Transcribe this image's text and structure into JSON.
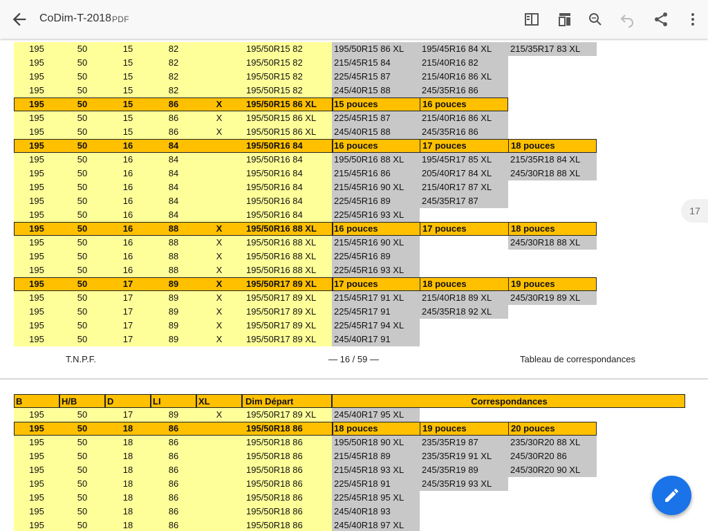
{
  "app": {
    "title": "CoDim-T-2018",
    "type_label": "PDF",
    "page_badge": "17"
  },
  "toolbar": {
    "icons": [
      "back-arrow-icon",
      "reading-mode-icon",
      "bookmark-view-icon",
      "search-icon",
      "undo-icon",
      "share-icon",
      "more-vert-icon"
    ]
  },
  "page16": {
    "rows": [
      {
        "kind": "n",
        "c": [
          "195",
          "50",
          "15",
          "82",
          "",
          "195/50R15 82"
        ],
        "g": [
          "195/50R15 86 XL",
          "195/45R16 84 XL",
          "215/35R17 83 XL"
        ]
      },
      {
        "kind": "n",
        "c": [
          "195",
          "50",
          "15",
          "82",
          "",
          "195/50R15 82"
        ],
        "g": [
          "215/45R15 84",
          "215/40R16 82",
          ""
        ]
      },
      {
        "kind": "n",
        "c": [
          "195",
          "50",
          "15",
          "82",
          "",
          "195/50R15 82"
        ],
        "g": [
          "225/45R15 87",
          "215/40R16 86 XL",
          ""
        ]
      },
      {
        "kind": "n",
        "c": [
          "195",
          "50",
          "15",
          "82",
          "",
          "195/50R15 82"
        ],
        "g": [
          "245/40R15 88",
          "245/35R16 86",
          ""
        ]
      },
      {
        "kind": "h",
        "c": [
          "195",
          "50",
          "15",
          "86",
          "X",
          "195/50R15 86 XL"
        ],
        "g": [
          "15 pouces",
          "16 pouces",
          ""
        ]
      },
      {
        "kind": "n",
        "c": [
          "195",
          "50",
          "15",
          "86",
          "X",
          "195/50R15 86 XL"
        ],
        "g": [
          "225/45R15 87",
          "215/40R16 86 XL",
          ""
        ]
      },
      {
        "kind": "n",
        "c": [
          "195",
          "50",
          "15",
          "86",
          "X",
          "195/50R15 86 XL"
        ],
        "g": [
          "245/40R15 88",
          "245/35R16 86",
          ""
        ]
      },
      {
        "kind": "h",
        "c": [
          "195",
          "50",
          "16",
          "84",
          "",
          "195/50R16 84"
        ],
        "g": [
          "16 pouces",
          "17 pouces",
          "18 pouces"
        ]
      },
      {
        "kind": "n",
        "c": [
          "195",
          "50",
          "16",
          "84",
          "",
          "195/50R16 84"
        ],
        "g": [
          "195/50R16 88 XL",
          "195/45R17 85 XL",
          "215/35R18 84 XL"
        ]
      },
      {
        "kind": "n",
        "c": [
          "195",
          "50",
          "16",
          "84",
          "",
          "195/50R16 84"
        ],
        "g": [
          "215/45R16 86",
          "205/40R17 84 XL",
          "245/30R18 88 XL"
        ]
      },
      {
        "kind": "n",
        "c": [
          "195",
          "50",
          "16",
          "84",
          "",
          "195/50R16 84"
        ],
        "g": [
          "215/45R16 90 XL",
          "215/40R17 87 XL",
          ""
        ]
      },
      {
        "kind": "n",
        "c": [
          "195",
          "50",
          "16",
          "84",
          "",
          "195/50R16 84"
        ],
        "g": [
          "225/45R16 89",
          "245/35R17 87",
          ""
        ]
      },
      {
        "kind": "n",
        "c": [
          "195",
          "50",
          "16",
          "84",
          "",
          "195/50R16 84"
        ],
        "g": [
          "225/45R16 93 XL",
          "",
          ""
        ]
      },
      {
        "kind": "h",
        "c": [
          "195",
          "50",
          "16",
          "88",
          "X",
          "195/50R16 88 XL"
        ],
        "g": [
          "16 pouces",
          "17 pouces",
          "18 pouces"
        ]
      },
      {
        "kind": "n",
        "c": [
          "195",
          "50",
          "16",
          "88",
          "X",
          "195/50R16 88 XL"
        ],
        "g": [
          "215/45R16 90 XL",
          "",
          "245/30R18 88 XL"
        ]
      },
      {
        "kind": "n",
        "c": [
          "195",
          "50",
          "16",
          "88",
          "X",
          "195/50R16 88 XL"
        ],
        "g": [
          "225/45R16 89",
          "",
          ""
        ]
      },
      {
        "kind": "n",
        "c": [
          "195",
          "50",
          "16",
          "88",
          "X",
          "195/50R16 88 XL"
        ],
        "g": [
          "225/45R16 93 XL",
          "",
          ""
        ]
      },
      {
        "kind": "h",
        "c": [
          "195",
          "50",
          "17",
          "89",
          "X",
          "195/50R17 89 XL"
        ],
        "g": [
          "17 pouces",
          "18 pouces",
          "19 pouces"
        ]
      },
      {
        "kind": "n",
        "c": [
          "195",
          "50",
          "17",
          "89",
          "X",
          "195/50R17 89 XL"
        ],
        "g": [
          "215/45R17 91 XL",
          "215/40R18 89 XL",
          "245/30R19 89 XL"
        ]
      },
      {
        "kind": "n",
        "c": [
          "195",
          "50",
          "17",
          "89",
          "X",
          "195/50R17 89 XL"
        ],
        "g": [
          "225/45R17 91",
          "245/35R18 92 XL",
          ""
        ]
      },
      {
        "kind": "n",
        "c": [
          "195",
          "50",
          "17",
          "89",
          "X",
          "195/50R17 89 XL"
        ],
        "g": [
          "225/45R17 94 XL",
          "",
          ""
        ]
      },
      {
        "kind": "n",
        "c": [
          "195",
          "50",
          "17",
          "89",
          "X",
          "195/50R17 89 XL"
        ],
        "g": [
          "245/40R17 91",
          "",
          ""
        ]
      }
    ],
    "footer_left": "T.N.P.F.",
    "footer_center": "— 16 / 59 —",
    "footer_right": "Tableau de correspondances"
  },
  "page17": {
    "headers": [
      "B",
      "H/B",
      "D",
      "LI",
      "XL",
      "Dim Départ",
      "Correspondances"
    ],
    "rows": [
      {
        "kind": "n",
        "c": [
          "195",
          "50",
          "17",
          "89",
          "X",
          "195/50R17 89 XL"
        ],
        "g": [
          "245/40R17 95 XL",
          "",
          ""
        ]
      },
      {
        "kind": "h",
        "c": [
          "195",
          "50",
          "18",
          "86",
          "",
          "195/50R18 86"
        ],
        "g": [
          "18 pouces",
          "19 pouces",
          "20 pouces"
        ]
      },
      {
        "kind": "n",
        "c": [
          "195",
          "50",
          "18",
          "86",
          "",
          "195/50R18 86"
        ],
        "g": [
          "195/50R18 90 XL",
          "235/35R19 87",
          "235/30R20 88 XL"
        ]
      },
      {
        "kind": "n",
        "c": [
          "195",
          "50",
          "18",
          "86",
          "",
          "195/50R18 86"
        ],
        "g": [
          "215/45R18 89",
          "235/35R19 91 XL",
          "245/30R20 86"
        ]
      },
      {
        "kind": "n",
        "c": [
          "195",
          "50",
          "18",
          "86",
          "",
          "195/50R18 86"
        ],
        "g": [
          "215/45R18 93 XL",
          "245/35R19 89",
          "245/30R20 90 XL"
        ]
      },
      {
        "kind": "n",
        "c": [
          "195",
          "50",
          "18",
          "86",
          "",
          "195/50R18 86"
        ],
        "g": [
          "225/45R18 91",
          "245/35R19 93 XL",
          ""
        ]
      },
      {
        "kind": "n",
        "c": [
          "195",
          "50",
          "18",
          "86",
          "",
          "195/50R18 86"
        ],
        "g": [
          "225/45R18 95 XL",
          "",
          ""
        ]
      },
      {
        "kind": "n",
        "c": [
          "195",
          "50",
          "18",
          "86",
          "",
          "195/50R18 86"
        ],
        "g": [
          "245/40R18 93",
          "",
          ""
        ]
      },
      {
        "kind": "n",
        "c": [
          "195",
          "50",
          "18",
          "86",
          "",
          "195/50R18 86"
        ],
        "g": [
          "245/40R18 97 XL",
          "",
          ""
        ]
      }
    ]
  },
  "fab": {
    "icon": "edit-pencil-icon"
  }
}
